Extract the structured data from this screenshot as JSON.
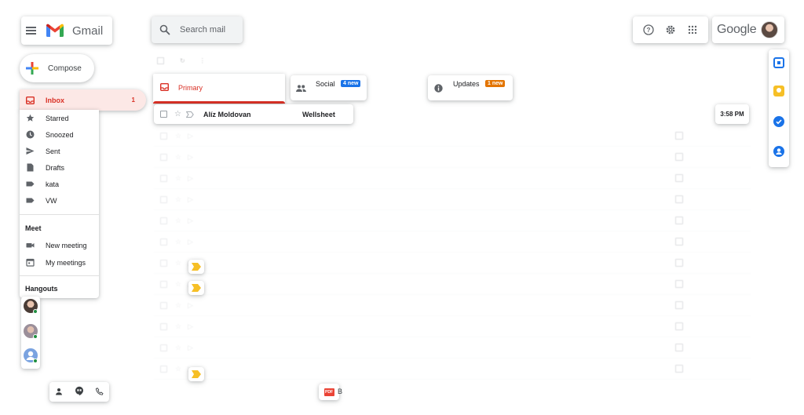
{
  "app": {
    "name": "Gmail",
    "brand": "Google"
  },
  "search": {
    "placeholder": "Search mail"
  },
  "compose": {
    "label": "Compose"
  },
  "nav": {
    "inbox": {
      "label": "Inbox",
      "count": "1"
    },
    "items": [
      {
        "label": "Starred",
        "icon": "star-icon"
      },
      {
        "label": "Snoozed",
        "icon": "clock-icon"
      },
      {
        "label": "Sent",
        "icon": "send-icon"
      },
      {
        "label": "Drafts",
        "icon": "draft-icon"
      },
      {
        "label": "kata",
        "icon": "label-icon"
      },
      {
        "label": "VW",
        "icon": "label-icon"
      }
    ]
  },
  "meet": {
    "heading": "Meet",
    "items": [
      {
        "label": "New meeting",
        "icon": "video-icon"
      },
      {
        "label": "My meetings",
        "icon": "calendar-icon"
      }
    ]
  },
  "hangouts": {
    "heading": "Hangouts"
  },
  "tabs": {
    "primary": {
      "label": "Primary"
    },
    "social": {
      "label": "Social",
      "badge": "4 new"
    },
    "updates": {
      "label": "Updates",
      "badge": "1 new"
    }
  },
  "selected_row": {
    "sender": "Alíz Moldovan",
    "subject": "Wellsheet",
    "time": "3:58 PM"
  },
  "colors": {
    "accent_red": "#d93025",
    "inbox_bg": "#fce8e6",
    "social_badge": "#1a73e8",
    "updates_badge": "#e37400",
    "tag_yellow": "#f6bf26"
  },
  "attachment": {
    "type": "PDF",
    "name_fragment": "B"
  }
}
